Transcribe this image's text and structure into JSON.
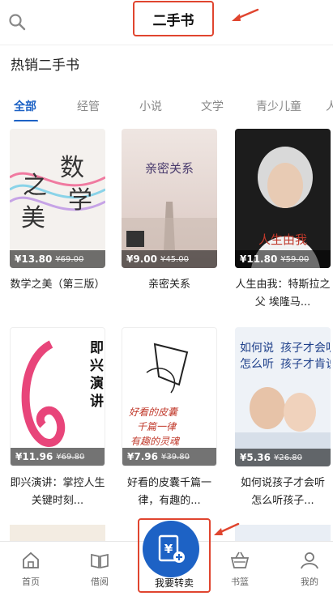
{
  "header": {
    "title": "二手书"
  },
  "section": {
    "title": "热销二手书"
  },
  "tabs": [
    {
      "label": "全部",
      "active": true
    },
    {
      "label": "经管",
      "active": false
    },
    {
      "label": "小说",
      "active": false
    },
    {
      "label": "文学",
      "active": false
    },
    {
      "label": "青少儿童",
      "active": false
    },
    {
      "label": "人",
      "active": false
    }
  ],
  "books": [
    {
      "title": "数学之美（第三版）",
      "price": "¥13.80",
      "orig": "¥69.00",
      "cover_text": "数学之美",
      "bg": "#f4f1ee"
    },
    {
      "title": "亲密关系",
      "price": "¥9.00",
      "orig": "¥45.00",
      "cover_text": "亲密关系",
      "bg": "#e9dcd6"
    },
    {
      "title": "人生由我：特斯拉之父 埃隆马...",
      "price": "¥11.80",
      "orig": "¥59.00",
      "cover_text": "人生由我",
      "bg": "#1c1c1c"
    },
    {
      "title": "即兴演讲：掌控人生关键时刻...",
      "price": "¥11.96",
      "orig": "¥69.80",
      "cover_text": "即兴演讲",
      "bg": "#ffffff"
    },
    {
      "title": "好看的皮囊千篇一律，有趣的...",
      "price": "¥7.96",
      "orig": "¥39.80",
      "cover_text": "好看的皮囊",
      "bg": "#ffffff"
    },
    {
      "title": "如何说孩子才会听 怎么听孩子...",
      "price": "¥5.36",
      "orig": "¥26.80",
      "cover_text": "如何说 孩子才会听",
      "bg": "#eef2f7"
    }
  ],
  "bottom_nav": {
    "home": "首页",
    "borrow": "借阅",
    "sell": "我要转卖",
    "basket": "书篮",
    "mine": "我的"
  },
  "colors": {
    "accent": "#1d62c5",
    "highlight": "#e0452f"
  }
}
